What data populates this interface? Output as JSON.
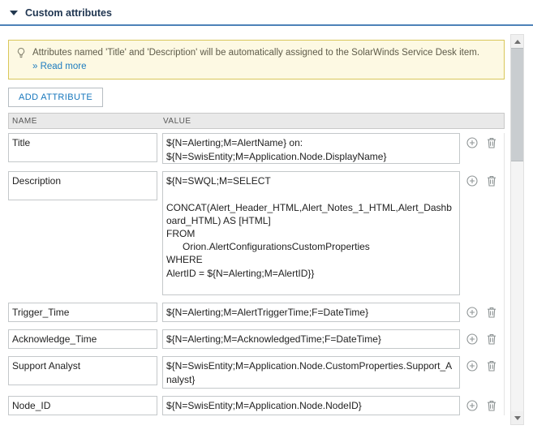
{
  "section": {
    "title": "Custom attributes"
  },
  "banner": {
    "text": "Attributes named 'Title' and 'Description' will be automatically assigned to the SolarWinds Service Desk item.",
    "read_more_label": "» Read more"
  },
  "toolbar": {
    "add_attribute_label": "ADD ATTRIBUTE"
  },
  "table": {
    "headers": {
      "name": "NAME",
      "value": "VALUE"
    },
    "rows": [
      {
        "name": "Title",
        "value": "${N=Alerting;M=AlertName} on:\n${N=SwisEntity;M=Application.Node.DisplayName}"
      },
      {
        "name": "Description",
        "value": "${N=SWQL;M=SELECT\n\nCONCAT(Alert_Header_HTML,Alert_Notes_1_HTML,Alert_Dashboard_HTML) AS [HTML]\nFROM\n      Orion.AlertConfigurationsCustomProperties\nWHERE\nAlertID = ${N=Alerting;M=AlertID}}"
      },
      {
        "name": "Trigger_Time",
        "value": "${N=Alerting;M=AlertTriggerTime;F=DateTime}"
      },
      {
        "name": "Acknowledge_Time",
        "value": "${N=Alerting;M=AcknowledgedTime;F=DateTime}"
      },
      {
        "name": "Support Analyst",
        "value": "${N=SwisEntity;M=Application.Node.CustomProperties.Support_Analyst}"
      },
      {
        "name": "Node_ID",
        "value": "${N=SwisEntity;M=Application.Node.NodeID}"
      }
    ]
  },
  "icons": {
    "collapse": "triangle-down",
    "banner": "lightbulb",
    "row_add": "plus-circle",
    "row_delete": "trash"
  },
  "colors": {
    "header_underline": "#4d82b8",
    "banner_bg": "#fdf9e3",
    "banner_border": "#d9c75a",
    "link_blue": "#1d7cc0",
    "button_text": "#1777bc",
    "table_header_bg": "#e9e9e9"
  }
}
